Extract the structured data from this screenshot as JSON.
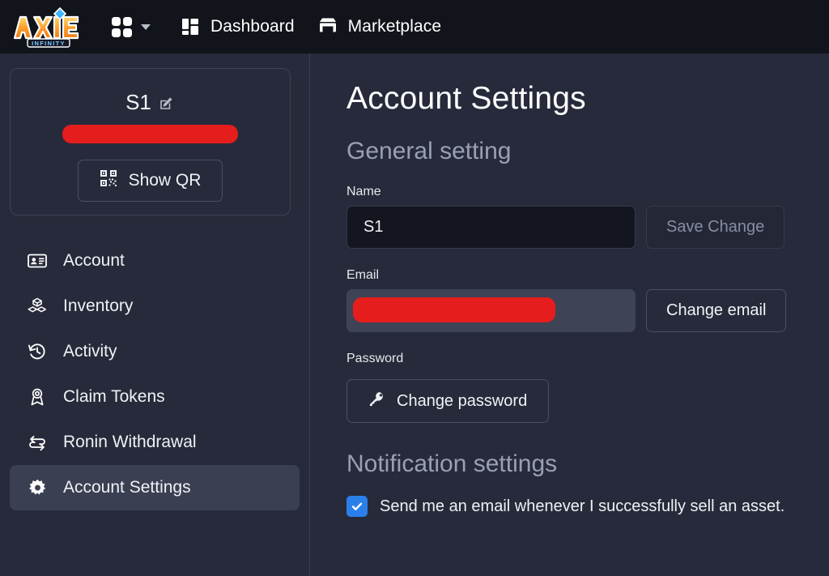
{
  "topbar": {
    "logo_alt": "Axie Infinity",
    "logo_word": "AXIE",
    "logo_sub": "INFINITY",
    "apps_icon": "apps-grid-icon",
    "caret_icon": "chevron-down-icon",
    "items": [
      {
        "label": "Dashboard",
        "icon": "dashboard-layout-icon"
      },
      {
        "label": "Marketplace",
        "icon": "storefront-icon"
      }
    ]
  },
  "sidebar": {
    "profile": {
      "name": "S1",
      "edit_icon": "edit-pencil-icon",
      "address_redacted": "",
      "qr_button_label": "Show QR",
      "qr_icon": "qr-code-icon"
    },
    "items": [
      {
        "label": "Account",
        "icon": "id-card-icon",
        "active": false
      },
      {
        "label": "Inventory",
        "icon": "boxes-icon",
        "active": false
      },
      {
        "label": "Activity",
        "icon": "history-clock-icon",
        "active": false
      },
      {
        "label": "Claim Tokens",
        "icon": "award-ribbon-icon",
        "active": false
      },
      {
        "label": "Ronin Withdrawal",
        "icon": "exchange-arrows-icon",
        "active": false
      },
      {
        "label": "Account Settings",
        "icon": "gear-icon",
        "active": true
      }
    ]
  },
  "main": {
    "page_title": "Account Settings",
    "general": {
      "section_title": "General setting",
      "name_label": "Name",
      "name_value": "S1",
      "name_placeholder": "Name",
      "save_button": "Save Change",
      "save_disabled": true,
      "email_label": "Email",
      "email_value": "",
      "email_placeholder": "",
      "change_email_button": "Change email",
      "password_label": "Password",
      "change_password_button": "Change password",
      "password_icon": "key-icon"
    },
    "notifications": {
      "section_title": "Notification settings",
      "options": [
        {
          "label": "Send me an email whenever I successfully sell an asset.",
          "checked": true
        }
      ]
    }
  },
  "colors": {
    "topbar_bg": "#12141b",
    "page_bg": "#272a3a",
    "active_item_bg": "#3a3f52",
    "input_bg": "#14161f",
    "input_disabled_bg": "#3e4356",
    "border": "#4a4f64",
    "accent_blue": "#2b7fea",
    "redaction_red": "#e51d1c",
    "muted_text": "#9aa0b2",
    "disabled_text": "#878da0"
  }
}
